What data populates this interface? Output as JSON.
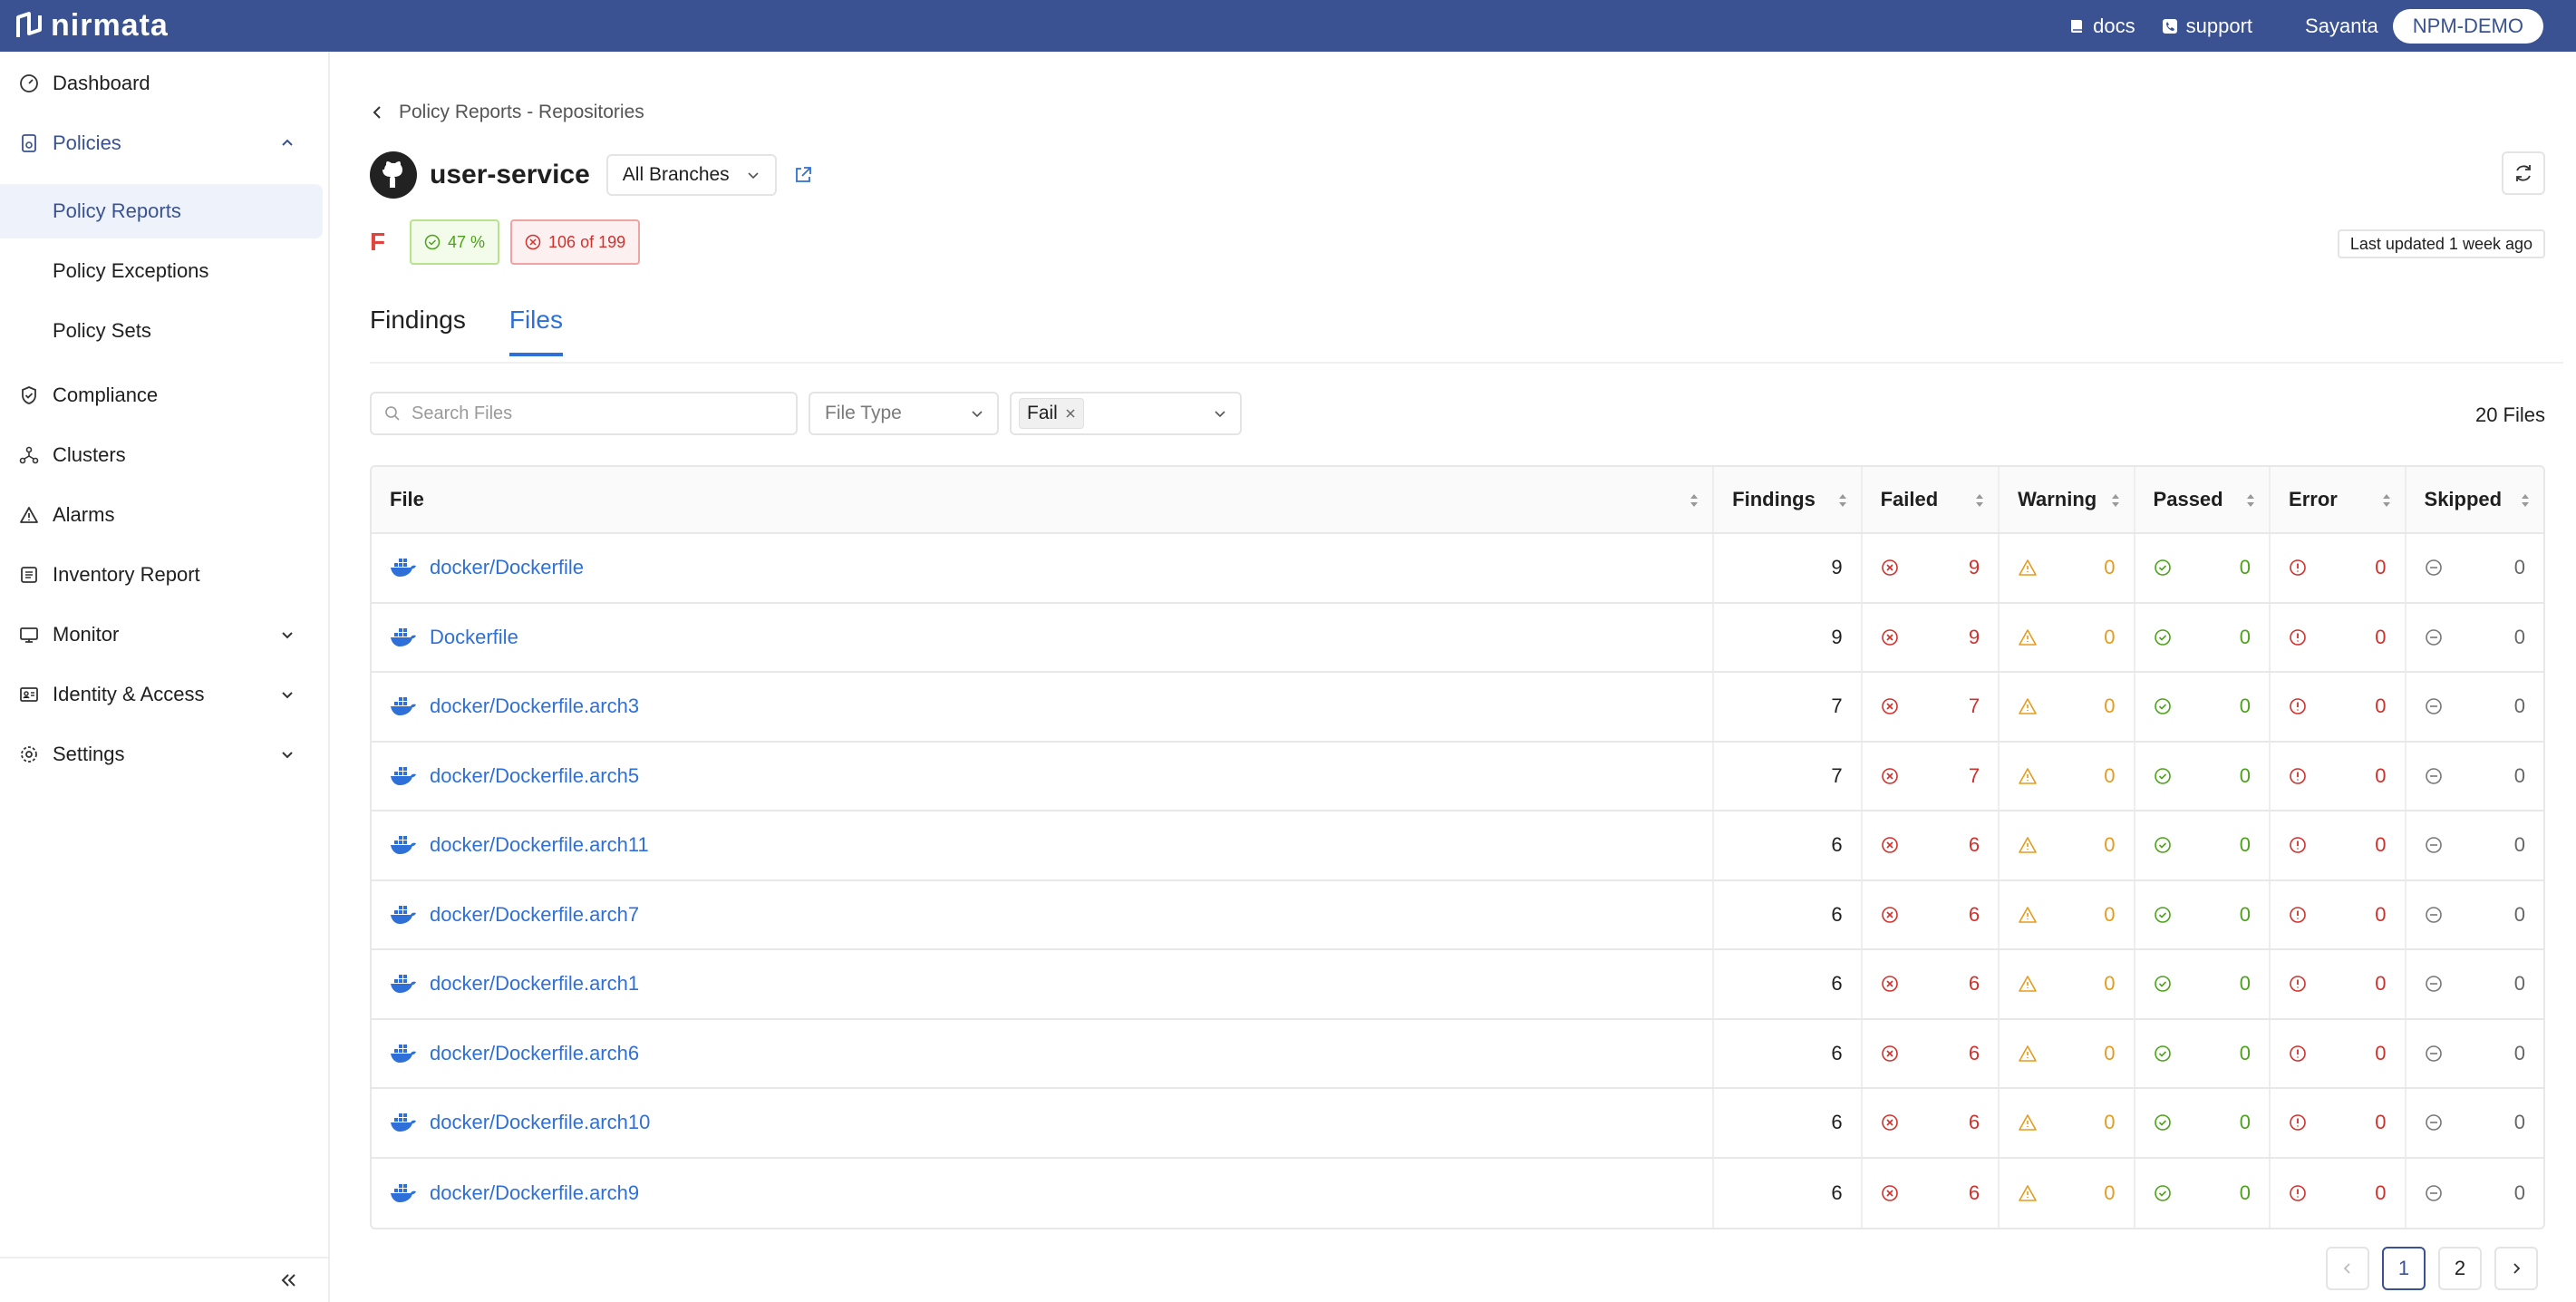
{
  "topbar": {
    "logo": "nirmata",
    "docs": "docs",
    "support": "support",
    "user": "Sayanta",
    "org": "NPM-DEMO"
  },
  "sidebar": {
    "items": [
      {
        "label": "Dashboard"
      },
      {
        "label": "Policies"
      },
      {
        "label": "Compliance"
      },
      {
        "label": "Clusters"
      },
      {
        "label": "Alarms"
      },
      {
        "label": "Inventory Report"
      },
      {
        "label": "Monitor"
      },
      {
        "label": "Identity & Access"
      },
      {
        "label": "Settings"
      }
    ],
    "policies_sub": [
      {
        "label": "Policy Reports"
      },
      {
        "label": "Policy Exceptions"
      },
      {
        "label": "Policy Sets"
      }
    ]
  },
  "breadcrumb": "Policy Reports - Repositories",
  "repo": {
    "name": "user-service",
    "branch": "All Branches",
    "grade": "F",
    "pass_pct": "47 %",
    "fail_count": "106 of 199",
    "last_updated": "Last updated 1 week ago"
  },
  "tabs": [
    {
      "label": "Findings"
    },
    {
      "label": "Files"
    }
  ],
  "filters": {
    "search_placeholder": "Search Files",
    "file_type": "File Type",
    "status_tag": "Fail",
    "count": "20 Files"
  },
  "table": {
    "headers": [
      "File",
      "Findings",
      "Failed",
      "Warning",
      "Passed",
      "Error",
      "Skipped"
    ],
    "rows": [
      {
        "file": "docker/Dockerfile",
        "findings": "9",
        "failed": "9",
        "warning": "0",
        "passed": "0",
        "error": "0",
        "skipped": "0"
      },
      {
        "file": "Dockerfile",
        "findings": "9",
        "failed": "9",
        "warning": "0",
        "passed": "0",
        "error": "0",
        "skipped": "0"
      },
      {
        "file": "docker/Dockerfile.arch3",
        "findings": "7",
        "failed": "7",
        "warning": "0",
        "passed": "0",
        "error": "0",
        "skipped": "0"
      },
      {
        "file": "docker/Dockerfile.arch5",
        "findings": "7",
        "failed": "7",
        "warning": "0",
        "passed": "0",
        "error": "0",
        "skipped": "0"
      },
      {
        "file": "docker/Dockerfile.arch11",
        "findings": "6",
        "failed": "6",
        "warning": "0",
        "passed": "0",
        "error": "0",
        "skipped": "0"
      },
      {
        "file": "docker/Dockerfile.arch7",
        "findings": "6",
        "failed": "6",
        "warning": "0",
        "passed": "0",
        "error": "0",
        "skipped": "0"
      },
      {
        "file": "docker/Dockerfile.arch1",
        "findings": "6",
        "failed": "6",
        "warning": "0",
        "passed": "0",
        "error": "0",
        "skipped": "0"
      },
      {
        "file": "docker/Dockerfile.arch6",
        "findings": "6",
        "failed": "6",
        "warning": "0",
        "passed": "0",
        "error": "0",
        "skipped": "0"
      },
      {
        "file": "docker/Dockerfile.arch10",
        "findings": "6",
        "failed": "6",
        "warning": "0",
        "passed": "0",
        "error": "0",
        "skipped": "0"
      },
      {
        "file": "docker/Dockerfile.arch9",
        "findings": "6",
        "failed": "6",
        "warning": "0",
        "passed": "0",
        "error": "0",
        "skipped": "0"
      }
    ]
  },
  "pagination": {
    "pages": [
      "1",
      "2"
    ],
    "current": "1"
  },
  "colors": {
    "brand": "#3a5291",
    "link": "#2f6fd8",
    "fail": "#d0312d",
    "warn": "#e59b1c",
    "pass": "#4ca21b"
  },
  "icons": {
    "file_row": "docker-icon",
    "failed": "x-circle-icon",
    "warning": "warning-triangle-icon",
    "passed": "check-circle-icon",
    "error": "exclamation-circle-icon",
    "skipped": "minus-circle-icon"
  }
}
